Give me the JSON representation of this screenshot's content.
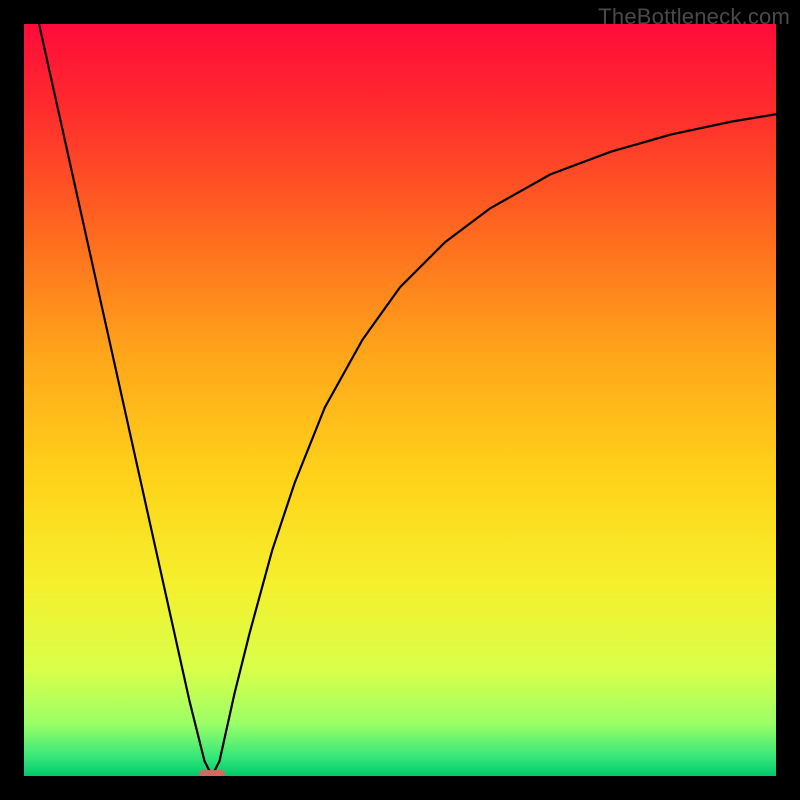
{
  "watermark": "TheBottleneck.com",
  "chart_data": {
    "type": "line",
    "title": "",
    "xlabel": "",
    "ylabel": "",
    "xlim": [
      0,
      100
    ],
    "ylim": [
      0,
      100
    ],
    "background_gradient": {
      "stops": [
        {
          "offset": 0.0,
          "color": "#ff0b3a"
        },
        {
          "offset": 0.12,
          "color": "#ff2e2d"
        },
        {
          "offset": 0.28,
          "color": "#ff6a1f"
        },
        {
          "offset": 0.44,
          "color": "#ffa61a"
        },
        {
          "offset": 0.6,
          "color": "#ffd21a"
        },
        {
          "offset": 0.74,
          "color": "#f6ef2b"
        },
        {
          "offset": 0.86,
          "color": "#d8ff4a"
        },
        {
          "offset": 0.93,
          "color": "#9bff66"
        },
        {
          "offset": 0.975,
          "color": "#35e77a"
        },
        {
          "offset": 1.0,
          "color": "#00c96b"
        }
      ]
    },
    "optimal_x": 25,
    "marker": {
      "x": 25,
      "y": 0,
      "w": 3.5,
      "h": 1.2,
      "color": "#d46a5e"
    },
    "series": [
      {
        "name": "bottleneck-curve",
        "color": "#000000",
        "points": [
          {
            "x": 2,
            "y": 100
          },
          {
            "x": 4,
            "y": 91
          },
          {
            "x": 6,
            "y": 82
          },
          {
            "x": 8,
            "y": 73
          },
          {
            "x": 10,
            "y": 64
          },
          {
            "x": 12,
            "y": 55
          },
          {
            "x": 14,
            "y": 46
          },
          {
            "x": 16,
            "y": 37
          },
          {
            "x": 18,
            "y": 28
          },
          {
            "x": 20,
            "y": 19
          },
          {
            "x": 22,
            "y": 10
          },
          {
            "x": 24,
            "y": 2
          },
          {
            "x": 25,
            "y": 0
          },
          {
            "x": 26,
            "y": 2
          },
          {
            "x": 28,
            "y": 11
          },
          {
            "x": 30,
            "y": 19
          },
          {
            "x": 33,
            "y": 30
          },
          {
            "x": 36,
            "y": 39
          },
          {
            "x": 40,
            "y": 49
          },
          {
            "x": 45,
            "y": 58
          },
          {
            "x": 50,
            "y": 65
          },
          {
            "x": 56,
            "y": 71
          },
          {
            "x": 62,
            "y": 75.5
          },
          {
            "x": 70,
            "y": 80
          },
          {
            "x": 78,
            "y": 83
          },
          {
            "x": 86,
            "y": 85.3
          },
          {
            "x": 94,
            "y": 87
          },
          {
            "x": 100,
            "y": 88
          }
        ]
      }
    ]
  }
}
